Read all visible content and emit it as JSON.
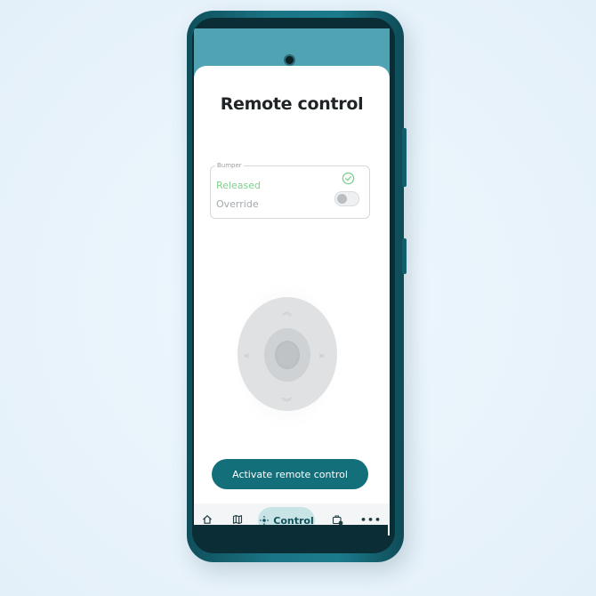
{
  "screen": {
    "title": "Remote control"
  },
  "bumper": {
    "legend": "Bumper",
    "released_label": "Released",
    "override_label": "Override",
    "override_enabled": false,
    "released_color": "#7fd08d"
  },
  "joystick": {
    "icons": [
      "chevron-up-icon",
      "chevron-down-icon",
      "chevron-left-icon",
      "chevron-right-icon"
    ]
  },
  "actions": {
    "activate_label": "Activate remote control",
    "activate_color": "#136f79"
  },
  "nav": {
    "items": [
      {
        "icon": "home-icon"
      },
      {
        "icon": "map-icon"
      },
      {
        "icon": "control-icon",
        "label": "Control",
        "active": true
      },
      {
        "icon": "tasks-icon"
      },
      {
        "icon": "more-icon"
      }
    ]
  },
  "colors": {
    "accent": "#136f79",
    "phone_frame": "#1a7585",
    "background": "#e8f3fb"
  }
}
